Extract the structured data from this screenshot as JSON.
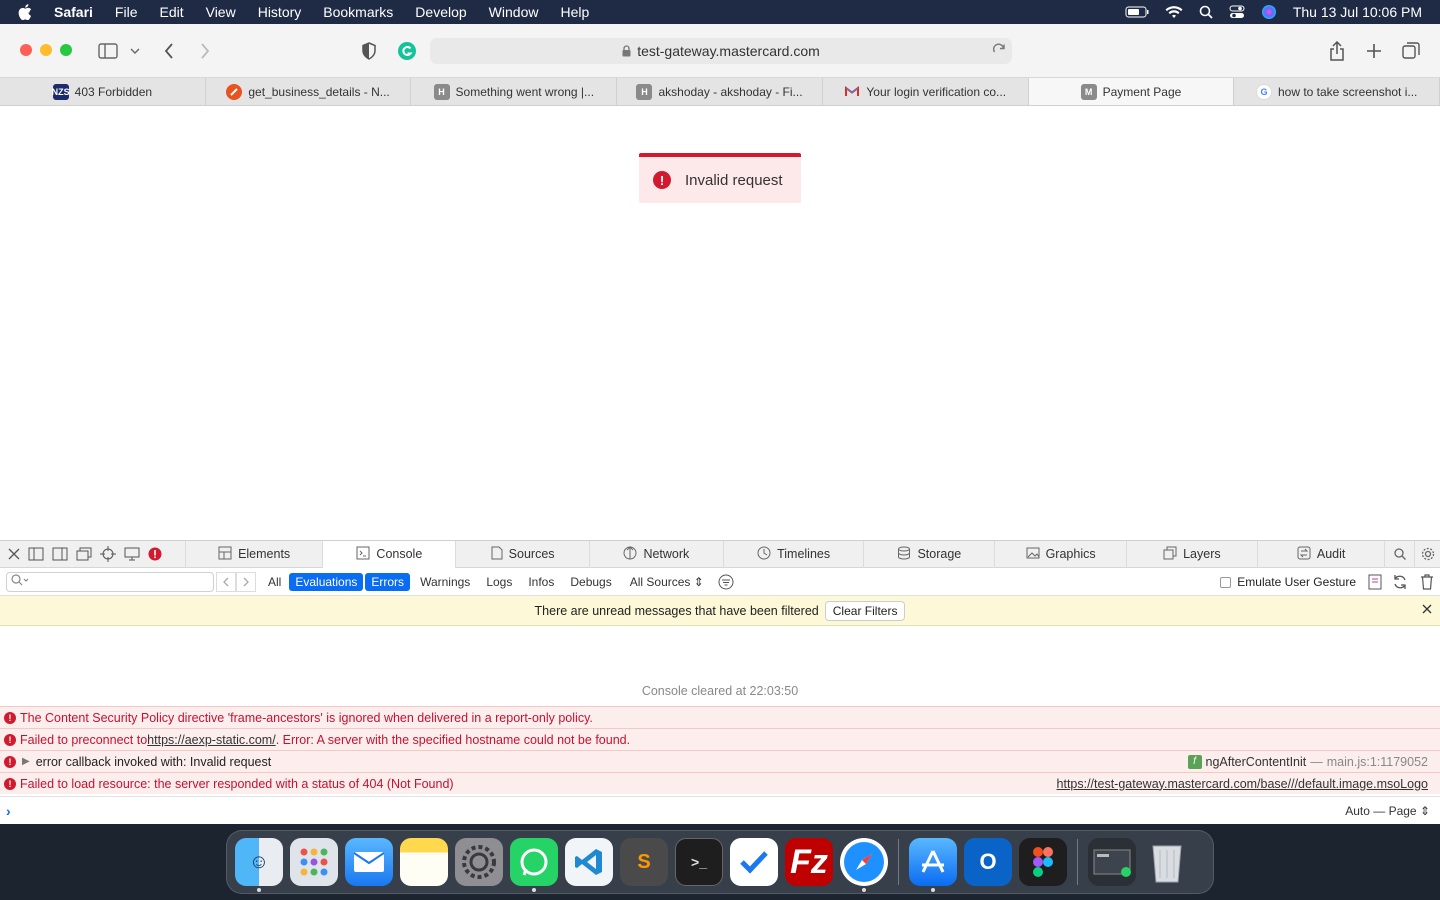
{
  "menubar": {
    "app": "Safari",
    "items": [
      "File",
      "Edit",
      "View",
      "History",
      "Bookmarks",
      "Develop",
      "Window",
      "Help"
    ],
    "datetime": "Thu 13 Jul  10:06 PM"
  },
  "browser": {
    "url": "test-gateway.mastercard.com",
    "tabs": [
      {
        "label": "403 Forbidden",
        "favicon": "NZS",
        "color": "#1c2a6b"
      },
      {
        "label": "get_business_details - N...",
        "favicon": "",
        "color": "#e8531f"
      },
      {
        "label": "Something went wrong |...",
        "favicon": "H",
        "color": "#8a8a8a"
      },
      {
        "label": "akshoday - akshoday - Fi...",
        "favicon": "H",
        "color": "#8a8a8a"
      },
      {
        "label": "Your login verification co...",
        "favicon": "M",
        "color": "#d93025"
      },
      {
        "label": "Payment Page",
        "favicon": "M",
        "color": "#8a8a8a",
        "active": true
      },
      {
        "label": "how to take screenshot i...",
        "favicon": "G",
        "color": "#4285f4"
      }
    ]
  },
  "page": {
    "toast": "Invalid request"
  },
  "devtools": {
    "tabs": [
      "Elements",
      "Console",
      "Sources",
      "Network",
      "Timelines",
      "Storage",
      "Graphics",
      "Layers",
      "Audit"
    ],
    "active_tab": "Console",
    "filters": [
      "All",
      "Evaluations",
      "Errors",
      "Warnings",
      "Logs",
      "Infos",
      "Debugs"
    ],
    "sources": "All Sources",
    "emulate": "Emulate User Gesture",
    "filtered_note": "There are unread messages that have been filtered",
    "clear_filters": "Clear Filters",
    "cleared": "Console cleared at 22:03:50",
    "messages": [
      {
        "text": "The Content Security Policy directive 'frame-ancestors' is ignored when delivered in a report-only policy."
      },
      {
        "pre": "Failed to preconnect to ",
        "link": "https://aexp-static.com/",
        "post": ". Error: A server with the specified hostname could not be found."
      },
      {
        "text": "error callback invoked with: Invalid request",
        "source_fn": "ngAfterContentInit",
        "source_sep": "—",
        "source_loc": "main.js:1:1179052"
      },
      {
        "text": "Failed to load resource: the server responded with a status of 404 (Not Found)",
        "source_link": "https://test-gateway.mastercard.com/base///default.image.msoLogo"
      }
    ],
    "context": "Auto — Page"
  },
  "dock": {
    "apps": [
      "Finder",
      "Launchpad",
      "Mail",
      "Notes",
      "System Settings",
      "WhatsApp",
      "Visual Studio Code",
      "Sublime Text",
      "Terminal",
      "Tasks",
      "FileZilla",
      "Safari",
      "App Store",
      "Outlook",
      "Figma",
      "Screenshot",
      "Trash"
    ]
  }
}
